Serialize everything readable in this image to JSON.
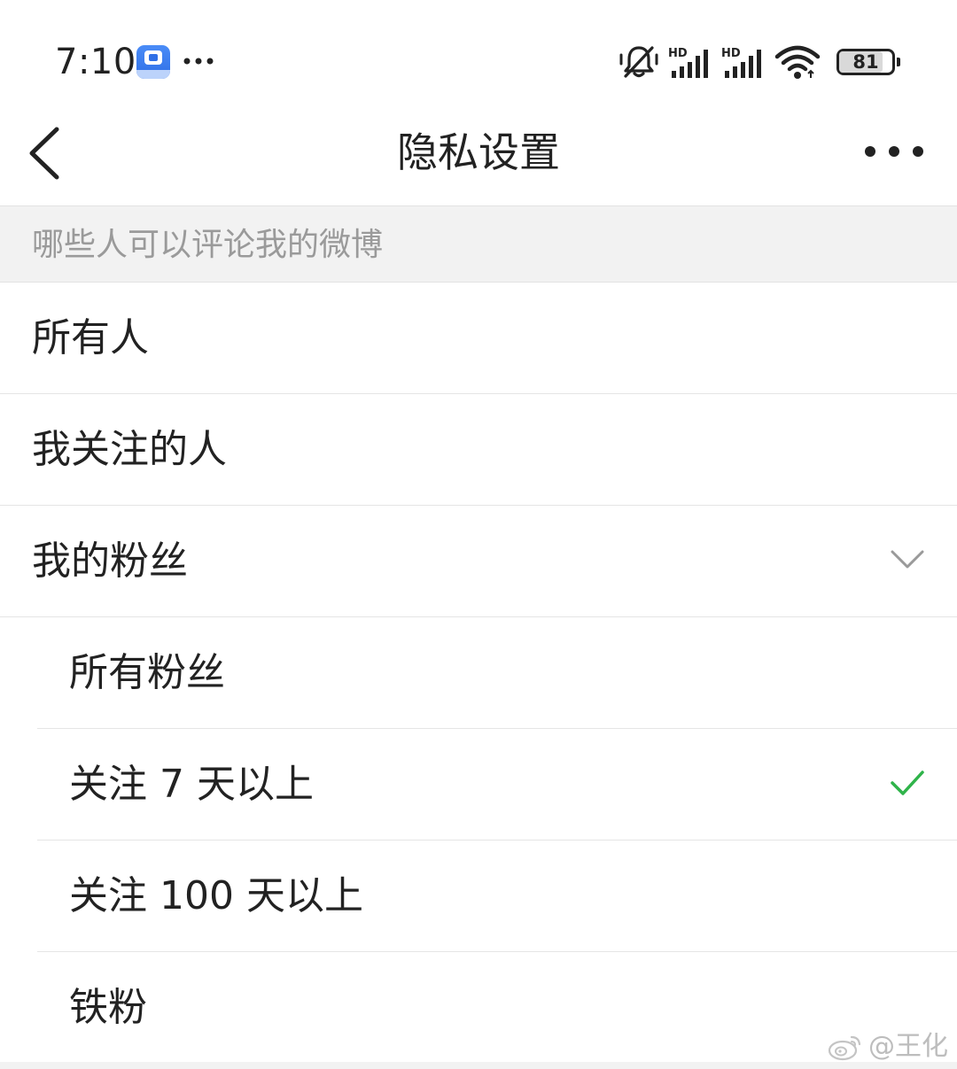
{
  "status_bar": {
    "time": "7:10",
    "battery_level": "81",
    "battery_fraction": 0.81,
    "icons": [
      "mi-oa-app-icon",
      "more-notifications-icon",
      "silent-bell-icon",
      "hd-signal-icon",
      "hd-signal-icon",
      "wifi-icon",
      "battery-icon"
    ]
  },
  "nav": {
    "title": "隐私设置",
    "back_icon": "chevron-left-icon",
    "more_icon": "more-horizontal-icon"
  },
  "section": {
    "header": "哪些人可以评论我的微博"
  },
  "options": [
    {
      "label": "所有人"
    },
    {
      "label": "我关注的人"
    },
    {
      "label": "我的粉丝",
      "expanded": true
    }
  ],
  "fan_options": [
    {
      "label": "所有粉丝",
      "selected": false
    },
    {
      "label": "关注 7 天以上",
      "selected": true
    },
    {
      "label": "关注 100 天以上",
      "selected": false
    },
    {
      "label": "铁粉",
      "selected": false
    }
  ],
  "watermark": {
    "text": "@王化",
    "icon": "weibo-logo-icon"
  },
  "colors": {
    "check": "#2fb34a",
    "section_bg": "#f2f2f2",
    "section_text": "#9a9a9a",
    "divider": "#e5e5e5"
  }
}
